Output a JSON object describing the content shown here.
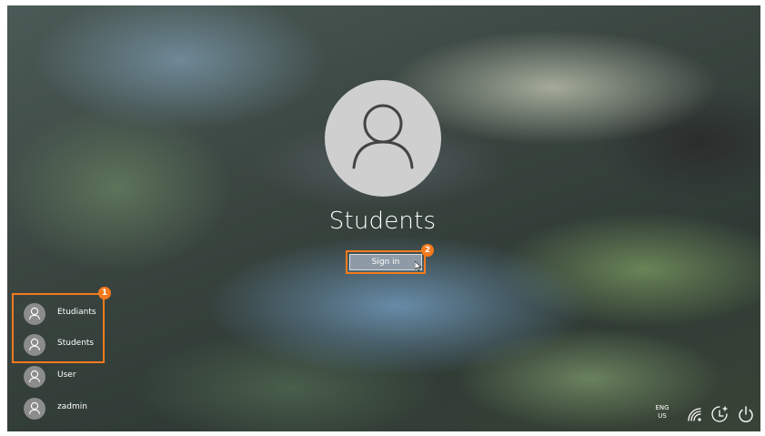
{
  "current_user": {
    "name": "Students",
    "avatar_icon": "user-icon"
  },
  "sign_in": {
    "label": "Sign in",
    "annotation": "2"
  },
  "user_list": {
    "annotation": "1",
    "items": [
      {
        "name": "Etudiants",
        "icon": "user-icon"
      },
      {
        "name": "Students",
        "icon": "user-icon"
      },
      {
        "name": "User",
        "icon": "user-icon"
      },
      {
        "name": "zadmin",
        "icon": "user-icon"
      }
    ]
  },
  "tray": {
    "language": {
      "primary": "ENG",
      "secondary": "US"
    },
    "icons": [
      "network-icon",
      "ease-of-access-icon",
      "power-icon"
    ]
  },
  "colors": {
    "annotation": "#f47a1e",
    "avatar_large": "#cfcfcf",
    "avatar_small": "#8c8c8c",
    "button": "#8e9aa6"
  }
}
